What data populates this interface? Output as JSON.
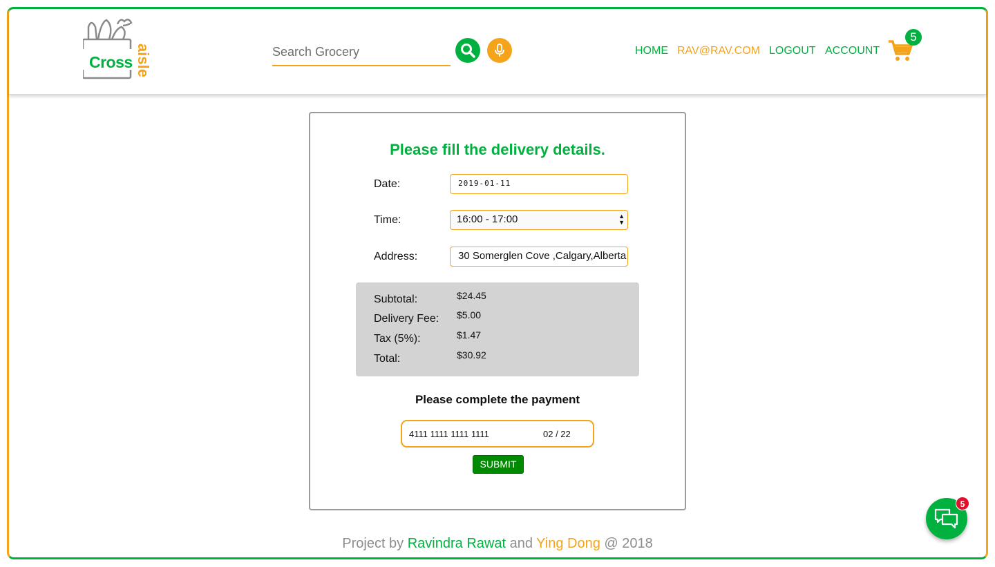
{
  "colors": {
    "green": "#00b140",
    "orange": "#f4a31a",
    "submit_green": "#008a00",
    "summary_bg": "#d3d3d3"
  },
  "logo": {
    "primary_text": "Cross",
    "secondary_text": "aisle",
    "icon": "grocery-bag-icon"
  },
  "search": {
    "placeholder": "Search Grocery",
    "value": "",
    "search_icon": "search-icon",
    "mic_icon": "microphone-icon"
  },
  "nav": {
    "home": "HOME",
    "email": "RAV@RAV.COM",
    "logout": "LOGOUT",
    "account": "ACCOUNT"
  },
  "cart": {
    "icon": "shopping-cart-icon",
    "count": "5"
  },
  "form": {
    "title": "Please fill the delivery details.",
    "date_label": "Date:",
    "date_value": "2019-01-11",
    "time_label": "Time:",
    "time_value": "16:00 - 17:00",
    "address_label": "Address:",
    "address_value": "30 Somerglen Cove ,Calgary,Alberta"
  },
  "summary": {
    "rows": [
      {
        "label": "Subtotal:",
        "value": "$24.45"
      },
      {
        "label": "Delivery Fee:",
        "value": "$5.00"
      },
      {
        "label": "Tax (5%):",
        "value": "$1.47"
      },
      {
        "label": "Total:",
        "value": "$30.92"
      }
    ]
  },
  "payment": {
    "title": "Please complete the payment",
    "card_number": "4111 1111 1111 1111",
    "expiry": "02 / 22",
    "submit_label": "SUBMIT"
  },
  "footer": {
    "prefix": "Project by ",
    "author1": "Ravindra Rawat",
    "joiner": " and ",
    "author2": "Ying Dong",
    "suffix": " @ 2018"
  },
  "chat": {
    "icon": "chat-bubbles-icon",
    "badge": "5"
  }
}
